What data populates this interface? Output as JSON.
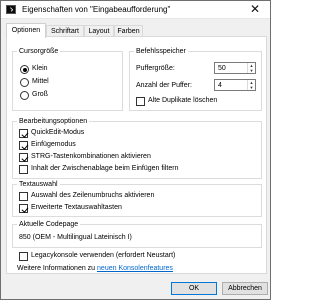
{
  "window": {
    "title": "Eigenschaften von \"Eingabeaufforderung\"",
    "close_glyph": "✕"
  },
  "tabs": [
    {
      "label": "Optionen",
      "active": true
    },
    {
      "label": "Schriftart",
      "active": false
    },
    {
      "label": "Layout",
      "active": false
    },
    {
      "label": "Farben",
      "active": false
    }
  ],
  "cursor": {
    "heading": "Cursorgröße",
    "options": [
      {
        "label": "Klein",
        "selected": true
      },
      {
        "label": "Mittel",
        "selected": false
      },
      {
        "label": "Groß",
        "selected": false
      }
    ]
  },
  "buffer": {
    "heading": "Befehlsspeicher",
    "size_label": "Puffergröße:",
    "size_value": "50",
    "count_label": "Anzahl der Puffer:",
    "count_value": "4",
    "discard_label": "Alte Duplikate löschen",
    "discard_checked": false
  },
  "editing": {
    "heading": "Bearbeitungsoptionen",
    "options": [
      {
        "label": "QuickEdit-Modus",
        "checked": true
      },
      {
        "label": "Einfügemodus",
        "checked": true
      },
      {
        "label": "STRG-Tastenkombinationen aktivieren",
        "checked": true
      },
      {
        "label": "Inhalt der Zwischenablage beim Einfügen filtern",
        "checked": false
      }
    ]
  },
  "textselect": {
    "heading": "Textauswahl",
    "options": [
      {
        "label": "Auswahl des Zeilenumbruchs aktivieren",
        "checked": false
      },
      {
        "label": "Erweiterte Textauswahltasten",
        "checked": true
      }
    ]
  },
  "codepage": {
    "heading": "Aktuelle Codepage",
    "value": "850   (OEM - Multilingual Lateinisch I)"
  },
  "legacy": {
    "label": "Legacykonsole verwenden (erfordert Neustart)",
    "checked": false
  },
  "more_info": {
    "prefix": "Weitere Informationen zu ",
    "link": "neuen Konsolenfeatures"
  },
  "buttons": {
    "ok": "OK",
    "cancel": "Abbrechen"
  }
}
